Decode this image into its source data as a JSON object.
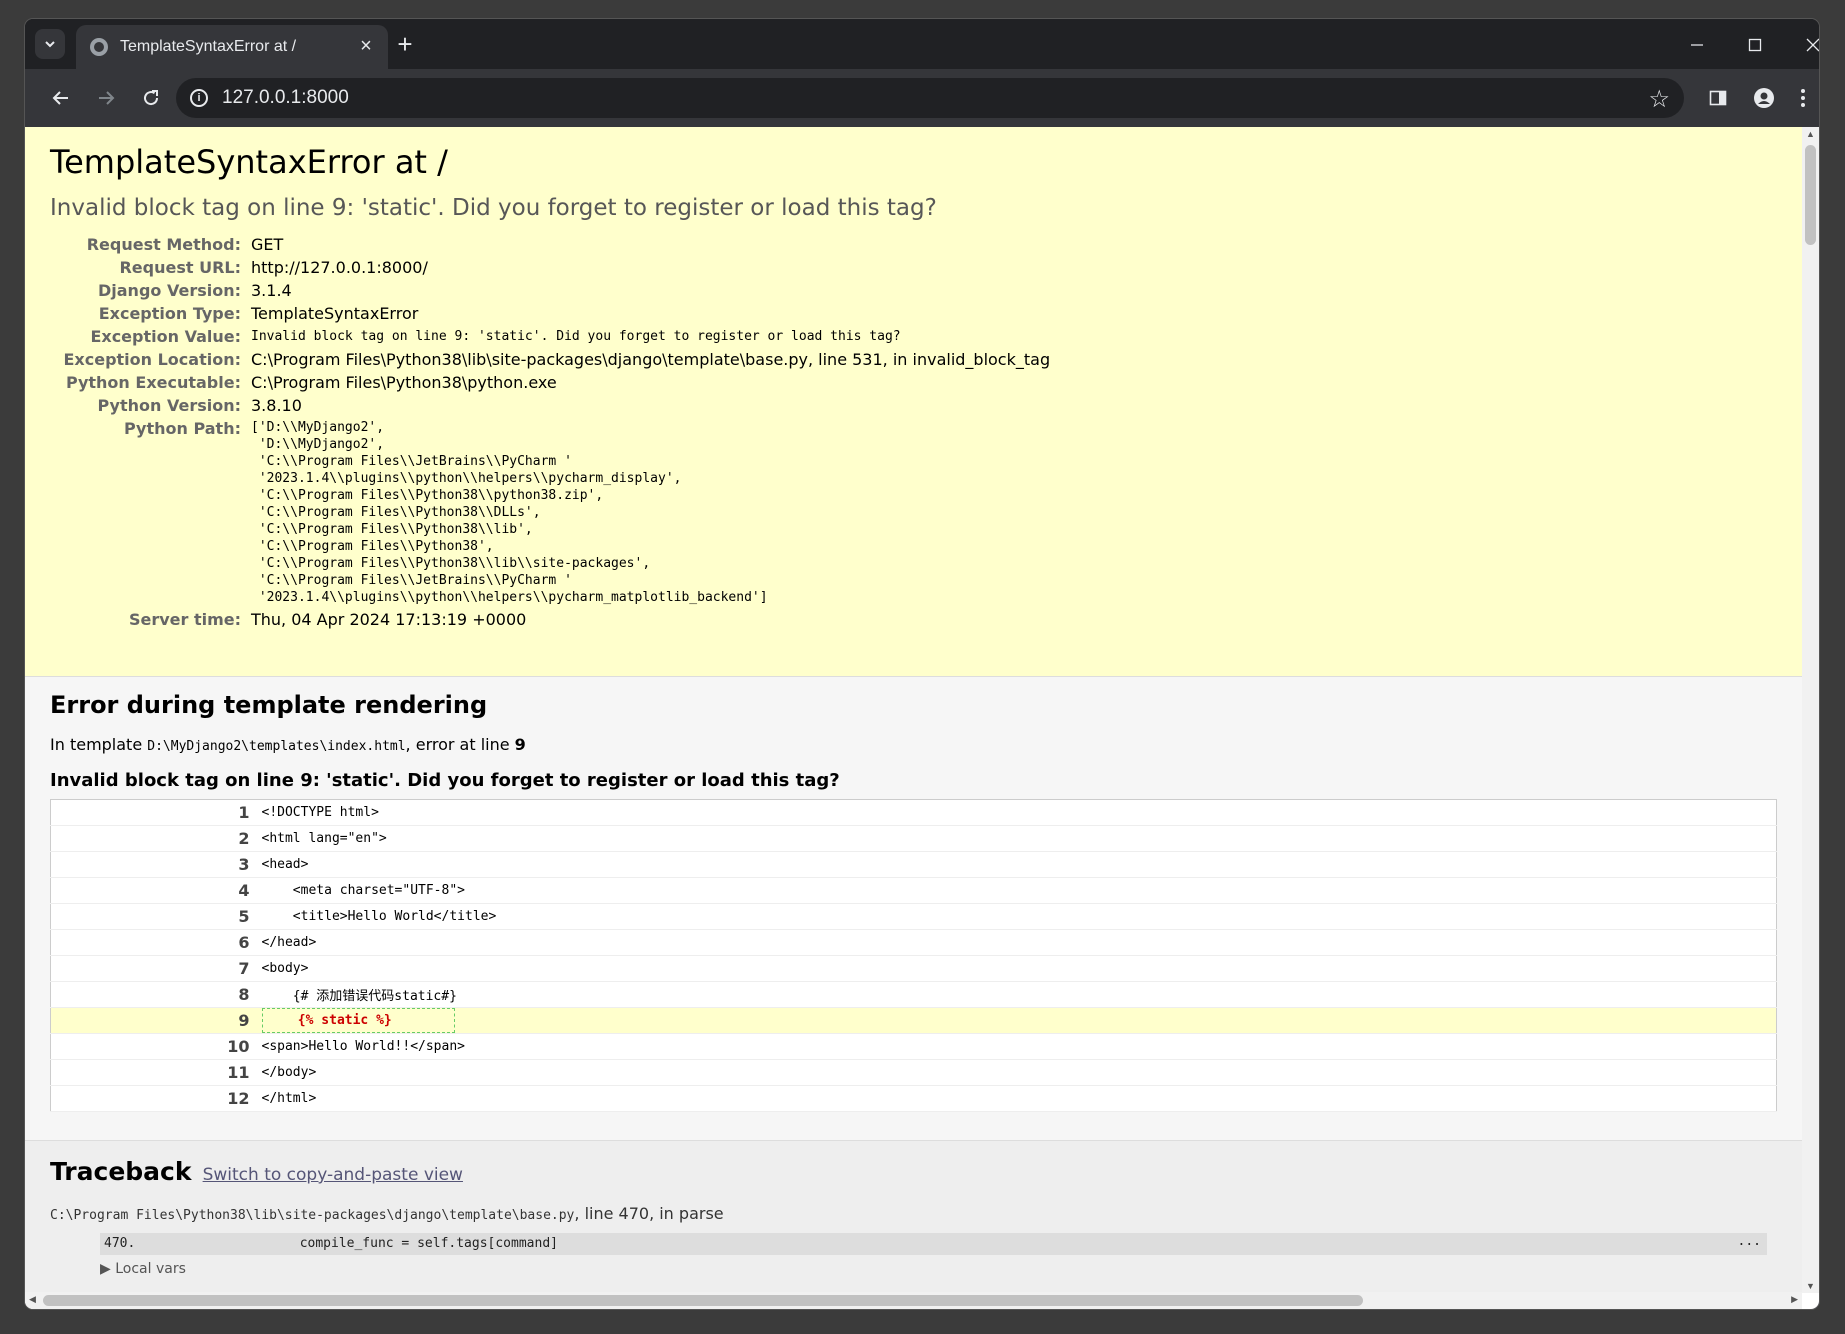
{
  "browser": {
    "tab_title": "TemplateSyntaxError at /",
    "url": "127.0.0.1:8000"
  },
  "summary": {
    "title": "TemplateSyntaxError at /",
    "message": "Invalid block tag on line 9: 'static'. Did you forget to register or load this tag?",
    "rows": [
      {
        "label": "Request Method:",
        "value": "GET"
      },
      {
        "label": "Request URL:",
        "value": "http://127.0.0.1:8000/"
      },
      {
        "label": "Django Version:",
        "value": "3.1.4"
      },
      {
        "label": "Exception Type:",
        "value": "TemplateSyntaxError"
      },
      {
        "label": "Exception Value:",
        "value": "Invalid block tag on line 9: 'static'. Did you forget to register or load this tag?"
      },
      {
        "label": "Exception Location:",
        "value": "C:\\Program Files\\Python38\\lib\\site-packages\\django\\template\\base.py, line 531, in invalid_block_tag"
      },
      {
        "label": "Python Executable:",
        "value": "C:\\Program Files\\Python38\\python.exe"
      },
      {
        "label": "Python Version:",
        "value": "3.8.10"
      },
      {
        "label": "Python Path:",
        "value": "['D:\\\\MyDjango2',\n 'D:\\\\MyDjango2',\n 'C:\\\\Program Files\\\\JetBrains\\\\PyCharm '\n '2023.1.4\\\\plugins\\\\python\\\\helpers\\\\pycharm_display',\n 'C:\\\\Program Files\\\\Python38\\\\python38.zip',\n 'C:\\\\Program Files\\\\Python38\\\\DLLs',\n 'C:\\\\Program Files\\\\Python38\\\\lib',\n 'C:\\\\Program Files\\\\Python38',\n 'C:\\\\Program Files\\\\Python38\\\\lib\\\\site-packages',\n 'C:\\\\Program Files\\\\JetBrains\\\\PyCharm '\n '2023.1.4\\\\plugins\\\\python\\\\helpers\\\\pycharm_matplotlib_backend']"
      },
      {
        "label": "Server time:",
        "value": "Thu, 04 Apr 2024 17:13:19 +0000"
      }
    ]
  },
  "template": {
    "heading": "Error during template rendering",
    "in_template_prefix": "In template ",
    "template_path": "D:\\MyDjango2\\templates\\index.html",
    "error_at_text": ", error at line ",
    "error_line": "9",
    "error_message": "Invalid block tag on line 9: 'static'. Did you forget to register or load this tag?",
    "lines": [
      {
        "num": "1",
        "code": "<!DOCTYPE html>"
      },
      {
        "num": "2",
        "code": "<html lang=\"en\">"
      },
      {
        "num": "3",
        "code": "<head>"
      },
      {
        "num": "4",
        "code": "    <meta charset=\"UTF-8\">"
      },
      {
        "num": "5",
        "code": "    <title>Hello World</title>"
      },
      {
        "num": "6",
        "code": "</head>"
      },
      {
        "num": "7",
        "code": "<body>"
      },
      {
        "num": "8",
        "code": "    {# 添加错误代码static#}"
      },
      {
        "num": "9",
        "code": "    {% static %}"
      },
      {
        "num": "10",
        "code": "<span>Hello World!!</span>"
      },
      {
        "num": "11",
        "code": "</body>"
      },
      {
        "num": "12",
        "code": "</html>"
      }
    ]
  },
  "traceback": {
    "heading": "Traceback",
    "switch_link": "Switch to copy-and-paste view",
    "frame_file": "C:\\Program Files\\Python38\\lib\\site-packages\\django\\template\\base.py",
    "frame_info": ", line 470, in parse",
    "line_no": "470.",
    "line_code": "compile_func = self.tags[command]",
    "dots": "...",
    "local_vars": "Local vars"
  }
}
